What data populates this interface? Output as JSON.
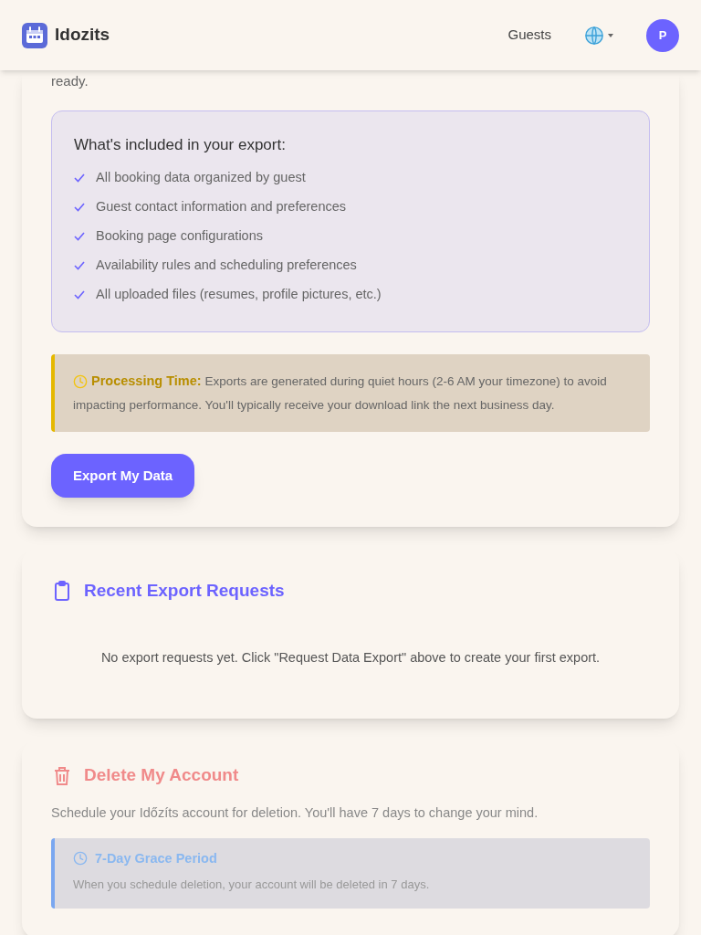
{
  "header": {
    "brand": "Idozits",
    "nav": [
      {
        "label": "Guests"
      }
    ],
    "avatar": "P"
  },
  "export_card": {
    "intro_tail": "ready.",
    "included_title": "What's included in your export:",
    "included": [
      "All booking data organized by guest",
      "Guest contact information and preferences",
      "Booking page configurations",
      "Availability rules and scheduling preferences",
      "All uploaded files (resumes, profile pictures, etc.)"
    ],
    "notice": {
      "title": "Processing Time:",
      "text": "Exports are generated during quiet hours (2-6 AM your timezone) to avoid impacting performance. You'll typically receive your download link the next business day."
    },
    "button": "Export My Data"
  },
  "requests_card": {
    "title": "Recent Export Requests",
    "empty": "No export requests yet. Click \"Request Data Export\" above to create your first export."
  },
  "delete_card": {
    "title": "Delete My Account",
    "text": "Schedule your Időzíts account for deletion. You'll have 7 days to change your mind.",
    "notice": {
      "title": "7-Day Grace Period",
      "text": "When you schedule deletion, your account will be deleted in 7 days."
    }
  }
}
